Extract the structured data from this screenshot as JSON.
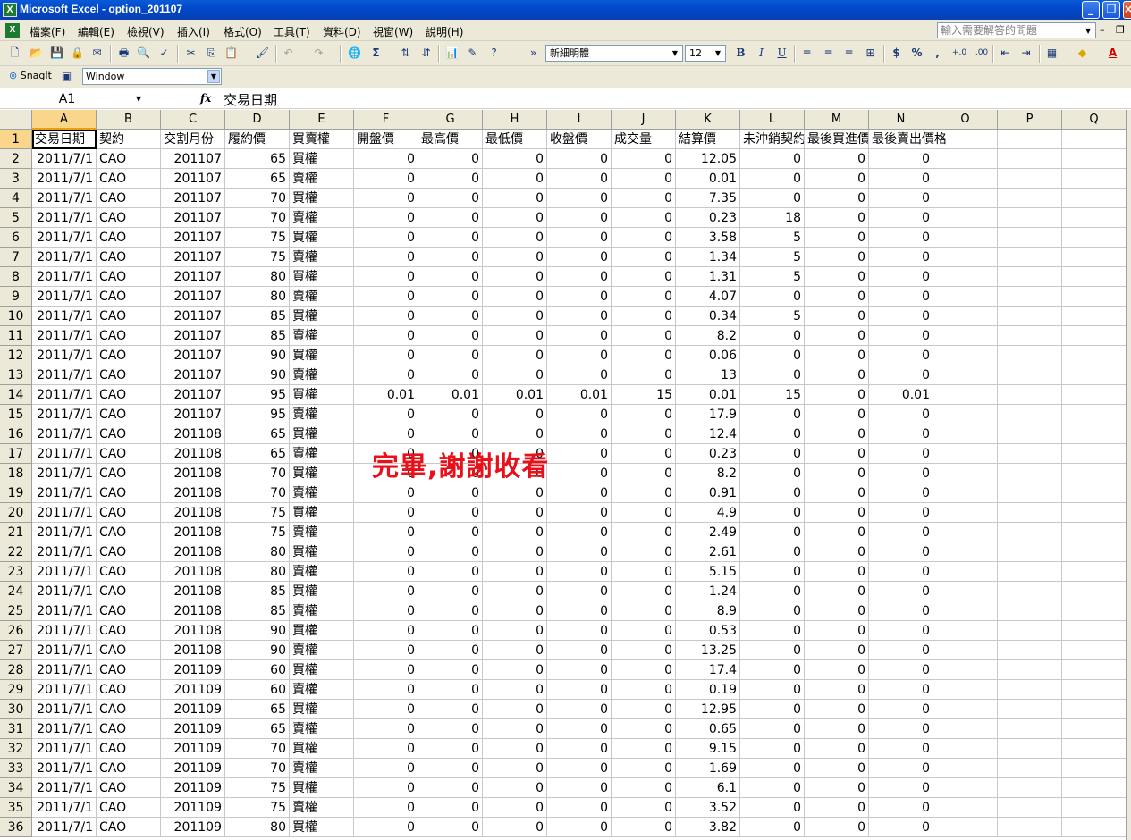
{
  "window": {
    "title": "Microsoft Excel - option_201107",
    "icon": "excel-icon"
  },
  "menu": {
    "items": [
      "檔案(F)",
      "編輯(E)",
      "檢視(V)",
      "插入(I)",
      "格式(O)",
      "工具(T)",
      "資料(D)",
      "視窗(W)",
      "說明(H)"
    ],
    "help_placeholder": "輸入需要解答的問題"
  },
  "toolbar": {
    "font_name": "新細明體",
    "font_size": "12",
    "sigma": "Σ",
    "bold": "B",
    "italic": "I",
    "underline": "U",
    "currency": "$",
    "percent": "%",
    "comma": ",",
    "inc_decimal": "+.0",
    "dec_decimal": ".00",
    "font_color": "A"
  },
  "snagit": {
    "label": "SnagIt",
    "target": "Window"
  },
  "formula_bar": {
    "name_box": "A1",
    "fx": "fx",
    "content": "交易日期"
  },
  "columns": [
    "A",
    "B",
    "C",
    "D",
    "E",
    "F",
    "G",
    "H",
    "I",
    "J",
    "K",
    "L",
    "M",
    "N",
    "O",
    "P",
    "Q"
  ],
  "header_row": [
    "交易日期",
    "契約",
    "交割月份",
    "履約價",
    "買賣權",
    "開盤價",
    "最高價",
    "最低價",
    "收盤價",
    "成交量",
    "結算價",
    "未沖銷契約",
    "最後買進價格",
    "最後賣出價格"
  ],
  "rows": [
    [
      "2011/7/1",
      "CAO",
      "201107",
      "65",
      "買權",
      "0",
      "0",
      "0",
      "0",
      "0",
      "12.05",
      "0",
      "0",
      "0"
    ],
    [
      "2011/7/1",
      "CAO",
      "201107",
      "65",
      "賣權",
      "0",
      "0",
      "0",
      "0",
      "0",
      "0.01",
      "0",
      "0",
      "0"
    ],
    [
      "2011/7/1",
      "CAO",
      "201107",
      "70",
      "買權",
      "0",
      "0",
      "0",
      "0",
      "0",
      "7.35",
      "0",
      "0",
      "0"
    ],
    [
      "2011/7/1",
      "CAO",
      "201107",
      "70",
      "賣權",
      "0",
      "0",
      "0",
      "0",
      "0",
      "0.23",
      "18",
      "0",
      "0"
    ],
    [
      "2011/7/1",
      "CAO",
      "201107",
      "75",
      "買權",
      "0",
      "0",
      "0",
      "0",
      "0",
      "3.58",
      "5",
      "0",
      "0"
    ],
    [
      "2011/7/1",
      "CAO",
      "201107",
      "75",
      "賣權",
      "0",
      "0",
      "0",
      "0",
      "0",
      "1.34",
      "5",
      "0",
      "0"
    ],
    [
      "2011/7/1",
      "CAO",
      "201107",
      "80",
      "買權",
      "0",
      "0",
      "0",
      "0",
      "0",
      "1.31",
      "5",
      "0",
      "0"
    ],
    [
      "2011/7/1",
      "CAO",
      "201107",
      "80",
      "賣權",
      "0",
      "0",
      "0",
      "0",
      "0",
      "4.07",
      "0",
      "0",
      "0"
    ],
    [
      "2011/7/1",
      "CAO",
      "201107",
      "85",
      "買權",
      "0",
      "0",
      "0",
      "0",
      "0",
      "0.34",
      "5",
      "0",
      "0"
    ],
    [
      "2011/7/1",
      "CAO",
      "201107",
      "85",
      "賣權",
      "0",
      "0",
      "0",
      "0",
      "0",
      "8.2",
      "0",
      "0",
      "0"
    ],
    [
      "2011/7/1",
      "CAO",
      "201107",
      "90",
      "買權",
      "0",
      "0",
      "0",
      "0",
      "0",
      "0.06",
      "0",
      "0",
      "0"
    ],
    [
      "2011/7/1",
      "CAO",
      "201107",
      "90",
      "賣權",
      "0",
      "0",
      "0",
      "0",
      "0",
      "13",
      "0",
      "0",
      "0"
    ],
    [
      "2011/7/1",
      "CAO",
      "201107",
      "95",
      "買權",
      "0.01",
      "0.01",
      "0.01",
      "0.01",
      "15",
      "0.01",
      "15",
      "0",
      "0.01"
    ],
    [
      "2011/7/1",
      "CAO",
      "201107",
      "95",
      "賣權",
      "0",
      "0",
      "0",
      "0",
      "0",
      "17.9",
      "0",
      "0",
      "0"
    ],
    [
      "2011/7/1",
      "CAO",
      "201108",
      "65",
      "買權",
      "0",
      "0",
      "0",
      "0",
      "0",
      "12.4",
      "0",
      "0",
      "0"
    ],
    [
      "2011/7/1",
      "CAO",
      "201108",
      "65",
      "賣權",
      "0",
      "0",
      "0",
      "0",
      "0",
      "0.23",
      "0",
      "0",
      "0"
    ],
    [
      "2011/7/1",
      "CAO",
      "201108",
      "70",
      "買權",
      "0",
      "0",
      "0",
      "0",
      "0",
      "8.2",
      "0",
      "0",
      "0"
    ],
    [
      "2011/7/1",
      "CAO",
      "201108",
      "70",
      "賣權",
      "0",
      "0",
      "0",
      "0",
      "0",
      "0.91",
      "0",
      "0",
      "0"
    ],
    [
      "2011/7/1",
      "CAO",
      "201108",
      "75",
      "買權",
      "0",
      "0",
      "0",
      "0",
      "0",
      "4.9",
      "0",
      "0",
      "0"
    ],
    [
      "2011/7/1",
      "CAO",
      "201108",
      "75",
      "賣權",
      "0",
      "0",
      "0",
      "0",
      "0",
      "2.49",
      "0",
      "0",
      "0"
    ],
    [
      "2011/7/1",
      "CAO",
      "201108",
      "80",
      "買權",
      "0",
      "0",
      "0",
      "0",
      "0",
      "2.61",
      "0",
      "0",
      "0"
    ],
    [
      "2011/7/1",
      "CAO",
      "201108",
      "80",
      "賣權",
      "0",
      "0",
      "0",
      "0",
      "0",
      "5.15",
      "0",
      "0",
      "0"
    ],
    [
      "2011/7/1",
      "CAO",
      "201108",
      "85",
      "買權",
      "0",
      "0",
      "0",
      "0",
      "0",
      "1.24",
      "0",
      "0",
      "0"
    ],
    [
      "2011/7/1",
      "CAO",
      "201108",
      "85",
      "賣權",
      "0",
      "0",
      "0",
      "0",
      "0",
      "8.9",
      "0",
      "0",
      "0"
    ],
    [
      "2011/7/1",
      "CAO",
      "201108",
      "90",
      "買權",
      "0",
      "0",
      "0",
      "0",
      "0",
      "0.53",
      "0",
      "0",
      "0"
    ],
    [
      "2011/7/1",
      "CAO",
      "201108",
      "90",
      "賣權",
      "0",
      "0",
      "0",
      "0",
      "0",
      "13.25",
      "0",
      "0",
      "0"
    ],
    [
      "2011/7/1",
      "CAO",
      "201109",
      "60",
      "買權",
      "0",
      "0",
      "0",
      "0",
      "0",
      "17.4",
      "0",
      "0",
      "0"
    ],
    [
      "2011/7/1",
      "CAO",
      "201109",
      "60",
      "賣權",
      "0",
      "0",
      "0",
      "0",
      "0",
      "0.19",
      "0",
      "0",
      "0"
    ],
    [
      "2011/7/1",
      "CAO",
      "201109",
      "65",
      "買權",
      "0",
      "0",
      "0",
      "0",
      "0",
      "12.95",
      "0",
      "0",
      "0"
    ],
    [
      "2011/7/1",
      "CAO",
      "201109",
      "65",
      "賣權",
      "0",
      "0",
      "0",
      "0",
      "0",
      "0.65",
      "0",
      "0",
      "0"
    ],
    [
      "2011/7/1",
      "CAO",
      "201109",
      "70",
      "買權",
      "0",
      "0",
      "0",
      "0",
      "0",
      "9.15",
      "0",
      "0",
      "0"
    ],
    [
      "2011/7/1",
      "CAO",
      "201109",
      "70",
      "賣權",
      "0",
      "0",
      "0",
      "0",
      "0",
      "1.69",
      "0",
      "0",
      "0"
    ],
    [
      "2011/7/1",
      "CAO",
      "201109",
      "75",
      "買權",
      "0",
      "0",
      "0",
      "0",
      "0",
      "6.1",
      "0",
      "0",
      "0"
    ],
    [
      "2011/7/1",
      "CAO",
      "201109",
      "75",
      "賣權",
      "0",
      "0",
      "0",
      "0",
      "0",
      "3.52",
      "0",
      "0",
      "0"
    ],
    [
      "2011/7/1",
      "CAO",
      "201109",
      "80",
      "買權",
      "0",
      "0",
      "0",
      "0",
      "0",
      "3.82",
      "0",
      "0",
      "0"
    ]
  ],
  "overlay_caption": "完畢,謝謝收看",
  "colors": {
    "overlay": "#e8101a",
    "active_header": "#f9d68c",
    "titlebar": "#0046c8"
  }
}
